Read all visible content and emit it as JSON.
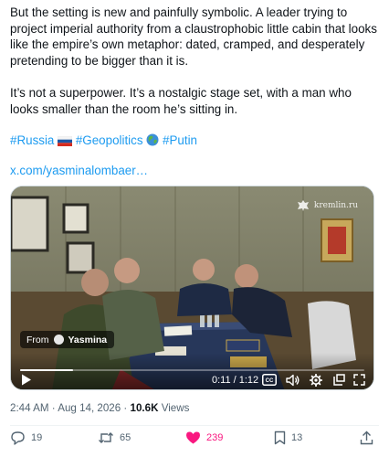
{
  "tweet": {
    "paragraph1": "But the setting is new and painfully symbolic. A leader trying to project imperial authority from a claustrophobic little cabin that looks like the empire’s own metaphor: dated, cramped, and desperately pretending to be bigger than it is.",
    "paragraph2": "It’s not a superpower. It’s a nostalgic stage set, with a man who looks smaller than the room he’s sitting in.",
    "hashtags": [
      "#Russia",
      "#Geopolitics",
      "#Putin"
    ],
    "link": "x.com/yasminalombaer…"
  },
  "video": {
    "watermark": "kremlin.ru",
    "from_label": "From",
    "from_name": "Yasmina",
    "time": "0:11 / 1:12",
    "progress": 0.153,
    "cc_label": "CC"
  },
  "meta": {
    "time": "2:44 AM",
    "separator": " · ",
    "date": "Aug 14, 2026",
    "views_count": "10.6K",
    "views_label": "Views"
  },
  "actions": {
    "replies": "19",
    "reposts": "65",
    "likes": "239",
    "bookmarks": "13",
    "like_color": "#f91880"
  }
}
